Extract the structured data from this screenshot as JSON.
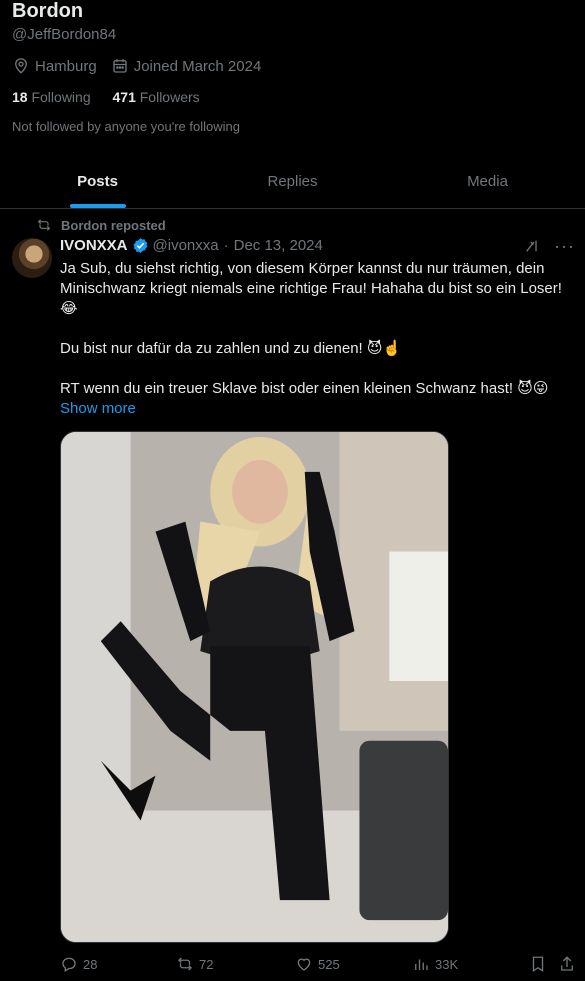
{
  "profile": {
    "display_name": "Bordon",
    "handle": "@JeffBordon84",
    "location": "Hamburg",
    "joined": "Joined March 2024",
    "following_count": "18",
    "following_label": "Following",
    "followers_count": "471",
    "followers_label": "Followers",
    "not_followed_note": "Not followed by anyone you're following"
  },
  "tabs": [
    {
      "label": "Posts",
      "active": true
    },
    {
      "label": "Replies",
      "active": false
    },
    {
      "label": "Media",
      "active": false
    }
  ],
  "post": {
    "repost_label": "Bordon reposted",
    "author_name": "IVONXXA",
    "author_handle": "@ivonxxa",
    "separator": "·",
    "date": "Dec 13, 2024",
    "text_line1": "Ja Sub, du siehst richtig, von diesem Körper kannst du nur träumen, dein Minischwanz kriegt niemals eine richtige Frau! Hahaha du bist so ein Loser! 😂",
    "text_line2": "Du bist nur dafür da zu zahlen und zu dienen! 😈☝️",
    "text_line3": "RT wenn du ein treuer Sklave bist oder einen kleinen Schwanz hast! 😈😜",
    "show_more": "Show more",
    "media_alt_icon": "photo",
    "stats": {
      "replies": "28",
      "reposts": "72",
      "likes": "525",
      "views": "33K"
    }
  },
  "colors": {
    "background": "#000000",
    "text_primary": "#e7e9ea",
    "text_muted": "#71767b",
    "accent": "#1d9bf0",
    "divider": "#2f3336"
  },
  "icons": [
    "location-icon",
    "calendar-icon",
    "repost-icon",
    "verified-icon",
    "grok-icon",
    "more-icon",
    "reply-icon",
    "retweet-icon",
    "like-icon",
    "views-icon",
    "bookmark-icon",
    "share-icon"
  ]
}
